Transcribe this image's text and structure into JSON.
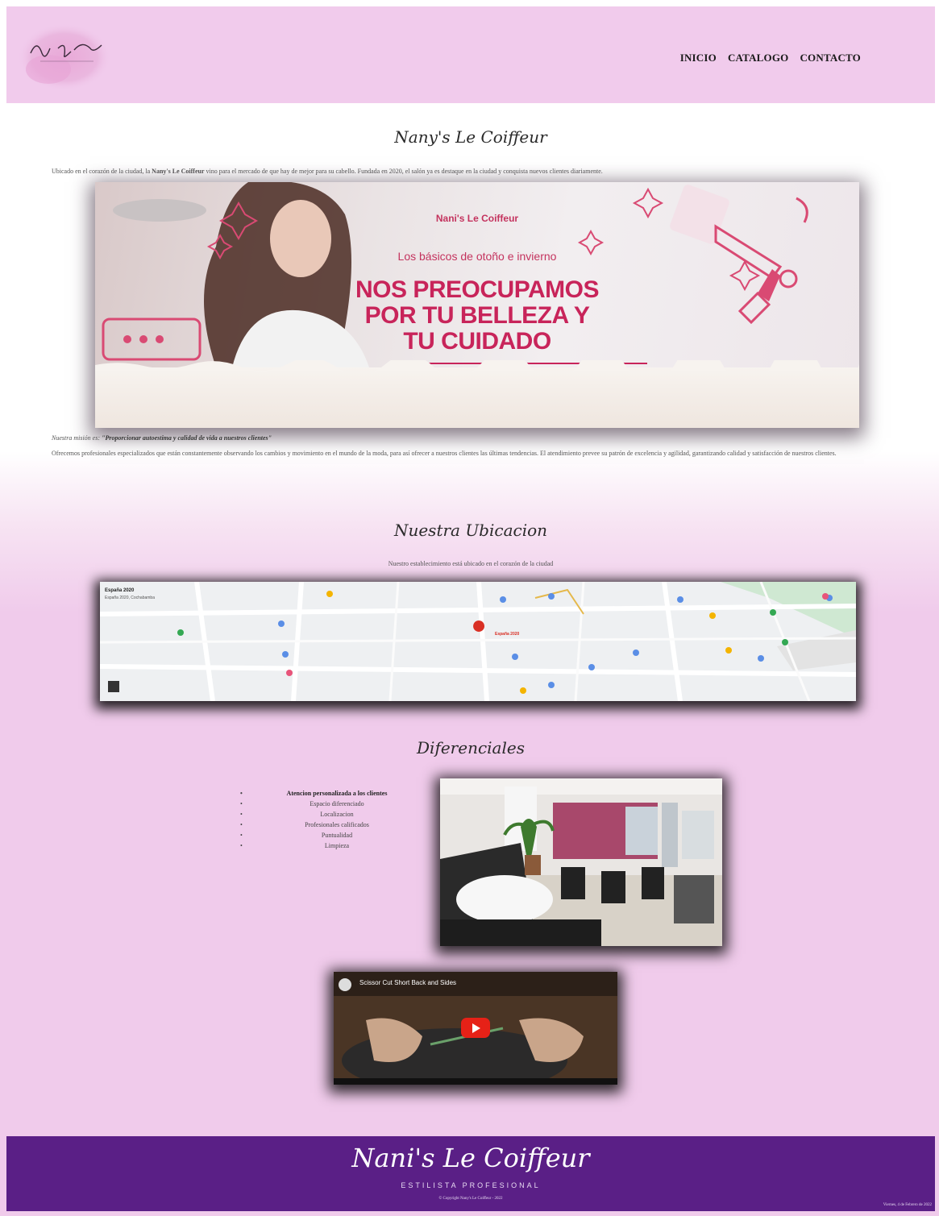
{
  "header": {
    "nav": [
      "INICIO",
      "CATALOGO",
      "CONTACTO"
    ]
  },
  "about": {
    "title": "Nany's Le Coiffeur",
    "intro_lead": "Ubicado en el corazón de la ciudad, la ",
    "intro_brand": "Nany's Le Coiffeur",
    "intro_rest": " vino para el mercado de que hay de mejor para su cabello. Fundada en 2020, el salón ya es destaque en la ciudad y conquista nuevos clientes diariamente.",
    "mission_lead": "Nuestra misión es: ",
    "mission_text": "\"Proporcionar autoestima y calidad de vida a nuestros clientes\"",
    "body": "Ofrecemos profesionales especializados que están constantemente observando los cambios y movimiento en el mundo de la moda, para así ofrecer a nuestros clientes las últimas tendencias. El atendimiento prevee su patrón de excelencia y agilidad, garantizando calidad y satisfacción de nuestros clientes."
  },
  "banner": {
    "brand": "Nani's Le Coiffeur",
    "subhead": "Los básicos de otoño e invierno",
    "headline_lines": [
      "Nos preocupamos",
      "por tu belleza y",
      "tu cuidado"
    ]
  },
  "location": {
    "title": "Nuestra Ubicacion",
    "subtitle": "Nuestro establecimiento está ubicado en el corazón de la ciudad",
    "map_place": "España 2020",
    "map_address": "España 2020, Cochabamba"
  },
  "differentials": {
    "title": "Diferenciales",
    "items": [
      "Atencion personalizada a los clientes",
      "Espacio diferenciado",
      "Localizacion",
      "Profesionales calificados",
      "Puntualidad",
      "Limpieza"
    ]
  },
  "video": {
    "title": "Scissor Cut Short Back and Sides"
  },
  "footer": {
    "logo": "Nani's Le Coiffeur",
    "subtitle": "ESTILISTA PROFESIONAL",
    "copyright": "© Copyright Nany's Le Coiffeur - 2022",
    "date": "Viernes, 4 de Febrero de 2022"
  },
  "colors": {
    "header_bg": "#f1cbec",
    "footer_bg": "#5a1f86",
    "accent": "#c8245a"
  }
}
